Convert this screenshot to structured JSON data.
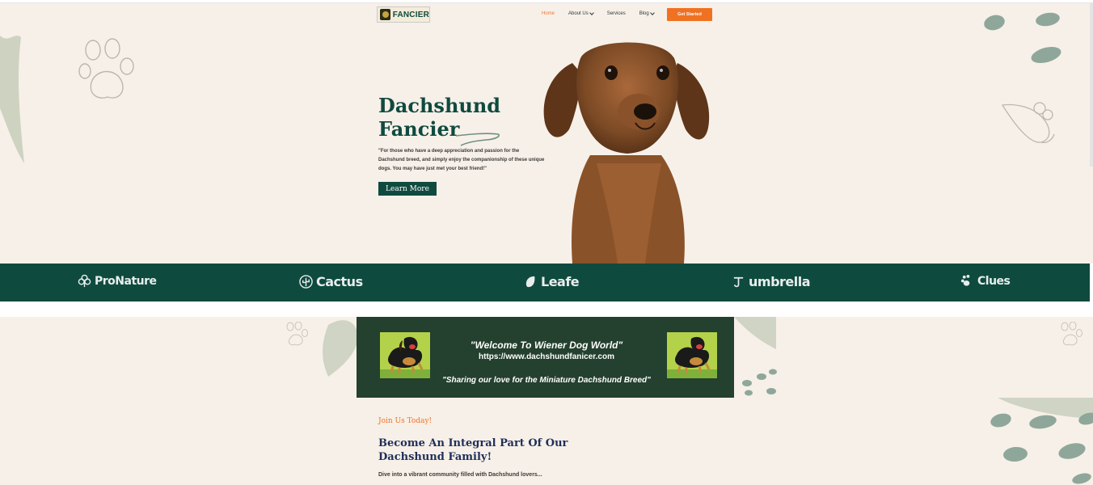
{
  "header": {
    "logo_text": "FANCIER",
    "nav": [
      {
        "label": "Home",
        "active": true,
        "has_dropdown": false
      },
      {
        "label": "About Us",
        "active": false,
        "has_dropdown": true
      },
      {
        "label": "Services",
        "active": false,
        "has_dropdown": false
      },
      {
        "label": "Blog",
        "active": false,
        "has_dropdown": true
      }
    ],
    "cta_label": "Get Started"
  },
  "hero": {
    "title_line1": "Dachshund",
    "title_line2": "Fancier",
    "quote": "\"For those who have a deep appreciation and passion for the Dachshund  breed, and simply enjoy the companionship of these unique dogs.  You may have just met your best friend!\"",
    "button_label": "Learn More"
  },
  "partners": [
    {
      "name": "ProNature",
      "icon": "leaf-cluster-icon"
    },
    {
      "name": "Cactus",
      "icon": "cactus-icon"
    },
    {
      "name": "Leafe",
      "icon": "leaf-icon"
    },
    {
      "name": "umbrella",
      "icon": "umbrella-icon"
    },
    {
      "name": "Clues",
      "icon": "paw-icon"
    }
  ],
  "banner": {
    "line1": "\"Welcome To Wiener Dog World\"",
    "line2": "https://www.dachshundfanicer.com",
    "line3": "\"Sharing our love for the Miniature Dachshund Breed\""
  },
  "join": {
    "eyebrow": "Join Us Today!",
    "headline": "Become An Integral Part Of Our Dachshund Family!",
    "description": "Dive into a vibrant community filled with Dachshund lovers..."
  },
  "colors": {
    "brand_green": "#0f4a3f",
    "accent_orange": "#f07122",
    "cream": "#f7f0e8",
    "sage": "#8fa79a"
  }
}
